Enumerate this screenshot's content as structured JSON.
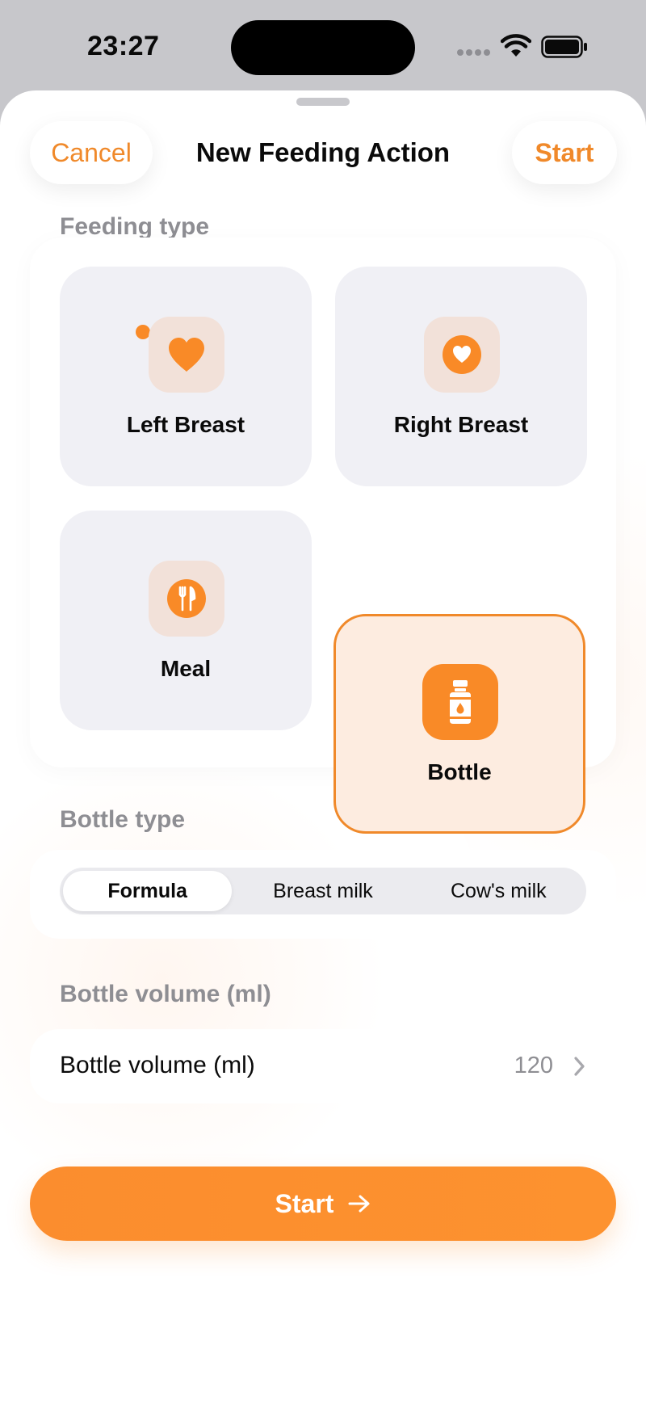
{
  "status_bar": {
    "time": "23:27"
  },
  "nav": {
    "cancel_label": "Cancel",
    "title": "New Feeding Action",
    "start_label": "Start"
  },
  "feeding_type": {
    "section_label": "Feeding type",
    "options": [
      {
        "label": "Left Breast",
        "icon": "heart-icon",
        "selected": false,
        "live_indicator": true
      },
      {
        "label": "Right Breast",
        "icon": "heart-circle-icon",
        "selected": false
      },
      {
        "label": "Meal",
        "icon": "fork-knife-icon",
        "selected": false
      },
      {
        "label": "Bottle",
        "icon": "bottle-icon",
        "selected": true
      }
    ]
  },
  "bottle_type": {
    "section_label": "Bottle type",
    "options": [
      "Formula",
      "Breast milk",
      "Cow's milk"
    ],
    "selected": "Formula"
  },
  "bottle_volume": {
    "section_label": "Bottle volume (ml)",
    "row_label": "Bottle volume (ml)",
    "value": "120"
  },
  "primary_action": {
    "label": "Start"
  },
  "colors": {
    "accent": "#F98A27",
    "tile_background": "#F0F0F5",
    "selected_tile_background": "#FDECE0",
    "icon_box": "#F2E1D9",
    "secondary_text": "#8E8E93"
  }
}
